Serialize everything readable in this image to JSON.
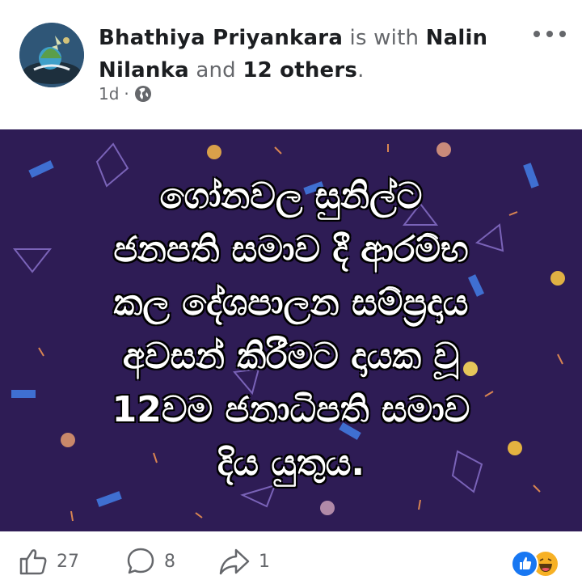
{
  "post": {
    "author": "Bhathiya Priyankara",
    "with_text": "is with",
    "tagged": "Nalin Nilanka",
    "and_text": "and",
    "others": "12 others",
    "period": ".",
    "time": "1d",
    "separator": "·",
    "privacy_icon": "globe-icon",
    "menu_icon": "more-icon",
    "image_text_lines": [
      "ගෝනවල සුනිල්ට",
      "ජනපති සමාව දී ආරම්භ",
      "කල දේශපාලන සම්ප්‍රදාය",
      "අවසන් කිරීමට දායක වූ",
      "12වම ජනාධිපති සමාව",
      "දිය යුතුය."
    ],
    "image_bg": "#2e1c55"
  },
  "actions": {
    "like_icon": "thumbs-up-icon",
    "like_count": "27",
    "comment_icon": "comment-icon",
    "comment_count": "8",
    "share_icon": "share-icon",
    "share_count": "1",
    "reaction_icons": [
      "like-reaction-icon",
      "haha-reaction-icon"
    ]
  },
  "colors": {
    "name": "#1c1e21",
    "secondary": "#65676b",
    "like_blue": "#1877f2",
    "haha_yellow": "#f7b125"
  }
}
